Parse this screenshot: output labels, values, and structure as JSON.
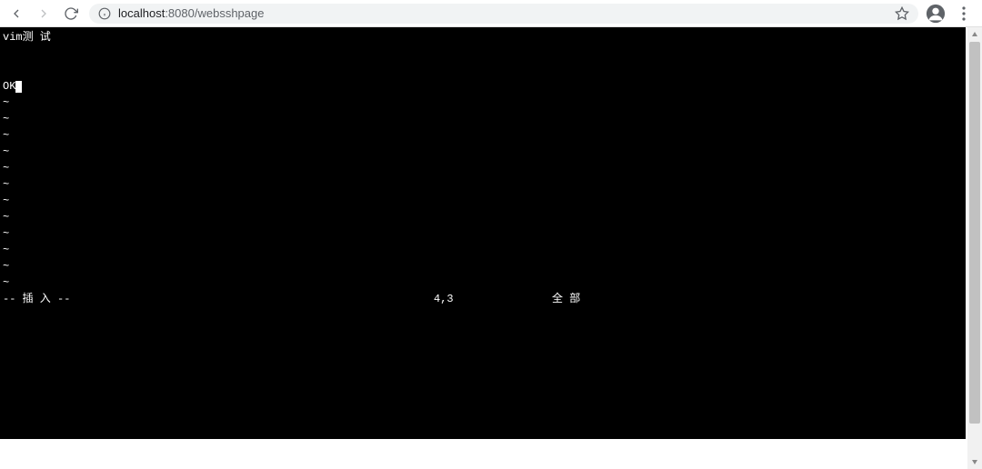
{
  "browser": {
    "url_host": "localhost",
    "url_port": ":8080",
    "url_path": "/websshpage"
  },
  "terminal": {
    "line1": "vim测 试",
    "line2": "",
    "line3": "",
    "line4_text": "OK",
    "tilde": "~",
    "status_mode": "-- 插 入 --",
    "status_position": "4,3",
    "status_scope": "全 部"
  }
}
